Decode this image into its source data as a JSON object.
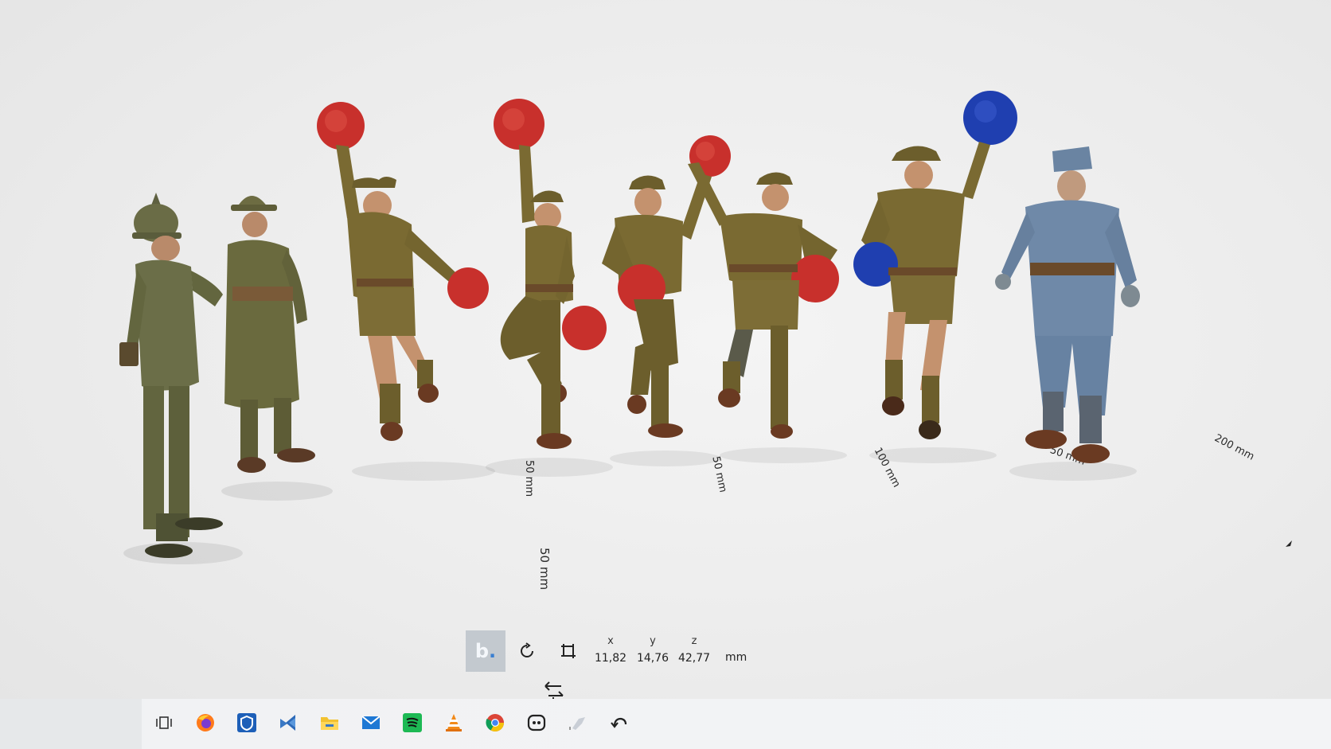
{
  "viewport": {
    "ruler_labels": [
      {
        "text": "50 mm"
      },
      {
        "text": "50 mm"
      },
      {
        "text": "100 mm"
      },
      {
        "text": "200 mm"
      },
      {
        "text": "50 mm"
      },
      {
        "text": "50 mm"
      }
    ],
    "figures": [
      {
        "name": "german-officer-figure",
        "uniform_color": "#6b6e48",
        "accessory": "pickelhaube"
      },
      {
        "name": "french-soldier-figure",
        "uniform_color": "#6a6a3e",
        "accessory": "adrian-helmet"
      },
      {
        "name": "dancer-figure-1",
        "uniform_color": "#7a6a32",
        "pompom_color": "#c8302c"
      },
      {
        "name": "dancer-figure-2",
        "uniform_color": "#7a6a32",
        "pompom_color": "#c8302c"
      },
      {
        "name": "dancer-figure-3",
        "uniform_color": "#7a6a32",
        "pompom_color": "#c8302c"
      },
      {
        "name": "dancer-figure-4",
        "uniform_color": "#7a6a32",
        "pompom_color": "#c8302c"
      },
      {
        "name": "dancer-figure-5",
        "uniform_color": "#7a6a32",
        "pompom_color": "#1f3fb0"
      },
      {
        "name": "blue-uniform-soldier-figure",
        "uniform_color": "#6f89a8",
        "accessory": "side-cap"
      }
    ]
  },
  "toolbar": {
    "logo_label": "b",
    "logo_dot": ".",
    "rotate_icon": "rotate-icon",
    "scale_icon": "scale-icon",
    "coords": [
      {
        "axis": "x",
        "value": "11,82"
      },
      {
        "axis": "y",
        "value": "14,76"
      },
      {
        "axis": "z",
        "value": "42,77"
      }
    ],
    "unit": "mm",
    "move_icon": "move-arrows-icon"
  },
  "taskbar": {
    "apps": [
      {
        "name": "task-view-icon"
      },
      {
        "name": "firefox-icon"
      },
      {
        "name": "shield-app-icon"
      },
      {
        "name": "vs-code-icon"
      },
      {
        "name": "file-explorer-icon"
      },
      {
        "name": "mail-icon"
      },
      {
        "name": "spotify-icon"
      },
      {
        "name": "vlc-icon"
      },
      {
        "name": "chrome-icon"
      },
      {
        "name": "game-app-icon"
      },
      {
        "name": "slicer-app-icon"
      },
      {
        "name": "undo-arrow-icon"
      }
    ]
  }
}
